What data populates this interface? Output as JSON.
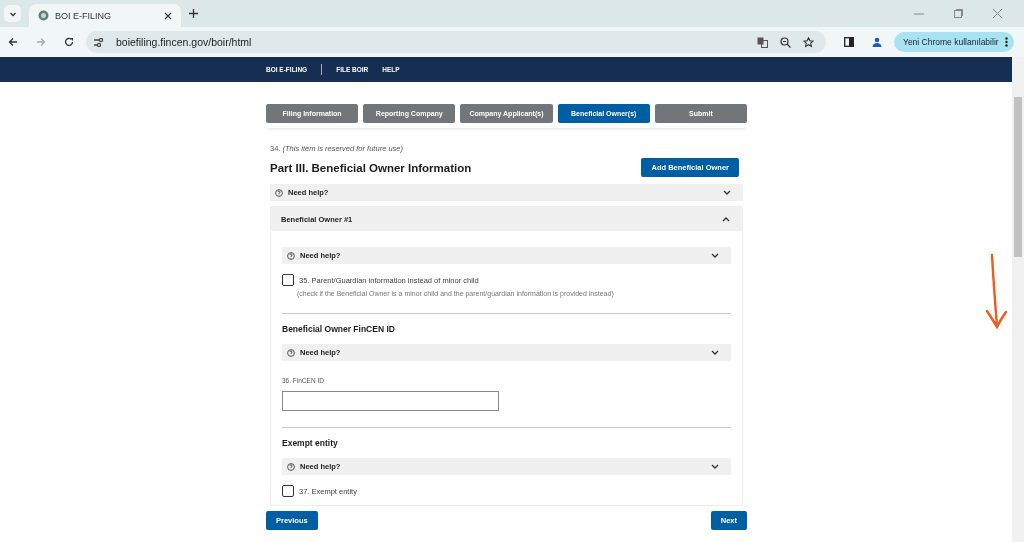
{
  "browser": {
    "tab_title": "BOI E-FILING",
    "url": "boiefiling.fincen.gov/boir/html",
    "update_button": "Yeni Chrome kullanılabilir"
  },
  "nav": [
    {
      "label": "BOI E-FILING"
    },
    {
      "label": "FILE BOIR"
    },
    {
      "label": "HELP"
    }
  ],
  "steps": [
    {
      "label": "Filing Information",
      "selected": false
    },
    {
      "label": "Reporting Company",
      "selected": false
    },
    {
      "label": "Company Applicant(s)",
      "selected": false
    },
    {
      "label": "Beneficial Owner(s)",
      "selected": true
    },
    {
      "label": "Submit",
      "selected": false
    }
  ],
  "reserved_note": "34. *(This item is reserved for future use)*",
  "heading": "Part III. Beneficial Owner Information",
  "add_button": "Add Beneficial Owner",
  "help": {
    "label": "Need help?",
    "expanded": false
  },
  "owner": {
    "title": "Beneficial Owner #1",
    "expanded": true,
    "items": [
      {
        "kind": "help",
        "label": "Need help?",
        "expanded": false
      },
      {
        "kind": "checkbox",
        "label": "35. Parent/Guardian information instead of minor child",
        "note": "(check if the Beneficial Owner is a minor child and the parent/guardian information is provided instead)",
        "checked": false
      },
      {
        "kind": "divider"
      },
      {
        "kind": "heading",
        "label": "Beneficial Owner FinCEN ID"
      },
      {
        "kind": "help",
        "label": "Need help?",
        "expanded": false
      },
      {
        "kind": "field",
        "label": "36. FinCEN ID"
      },
      {
        "kind": "divider"
      },
      {
        "kind": "heading",
        "label": "Exempt entity"
      },
      {
        "kind": "help",
        "label": "Need help?",
        "expanded": false
      },
      {
        "kind": "checkbox",
        "label": "37. Exempt entity",
        "checked": false
      }
    ]
  },
  "buttons": {
    "previous": "Previous",
    "next": "Next"
  }
}
